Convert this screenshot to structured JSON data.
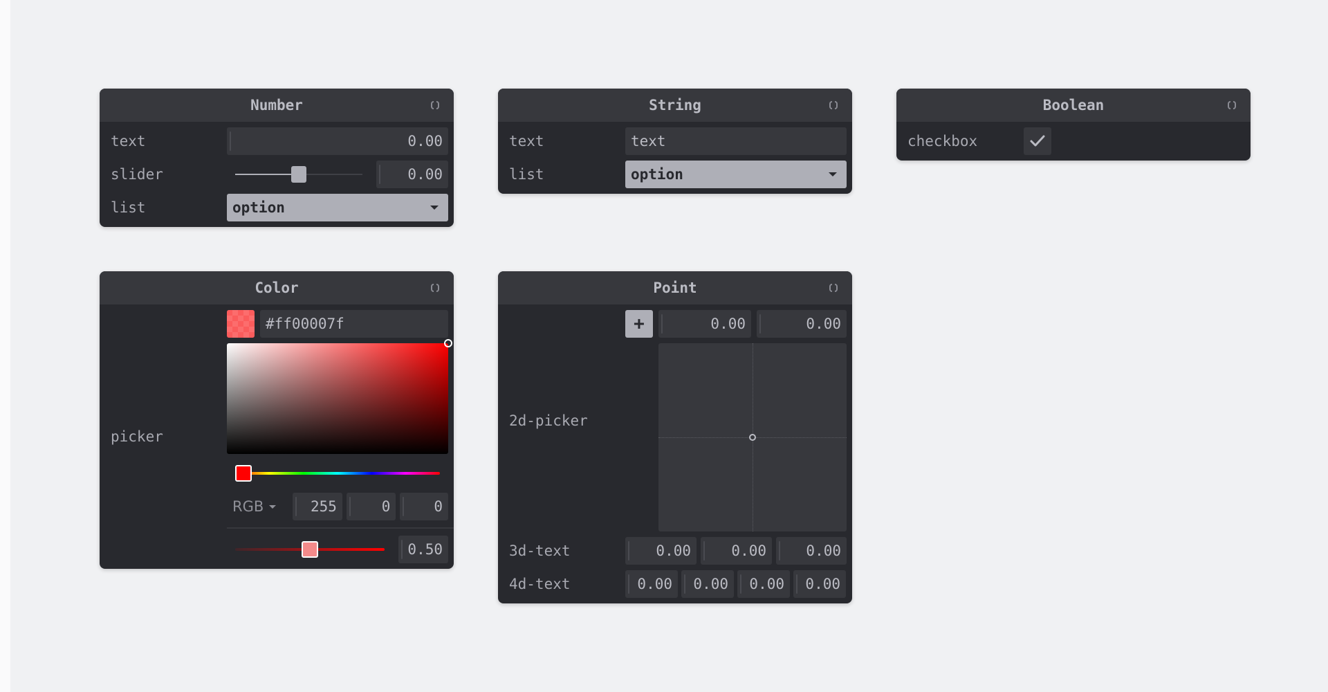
{
  "colors": {
    "page_bg": "#f0f1f3",
    "panel_bg": "#28292e",
    "header_bg": "#37383d",
    "accent": "#aeafb7",
    "picked_color": "#ff00007f"
  },
  "icons": {
    "fold": "fold-icon",
    "check": "check-icon",
    "plus": "plus-icon",
    "caret": "chevron-down-icon"
  },
  "number_panel": {
    "title": "Number",
    "text_label": "text",
    "text_value": "0.00",
    "slider_label": "slider",
    "slider_value": "0.00",
    "slider_fraction": 0.5,
    "list_label": "list",
    "list_value": "option"
  },
  "string_panel": {
    "title": "String",
    "text_label": "text",
    "text_value": "text",
    "list_label": "list",
    "list_value": "option"
  },
  "boolean_panel": {
    "title": "Boolean",
    "checkbox_label": "checkbox",
    "checked": true
  },
  "color_panel": {
    "title": "Color",
    "picker_label": "picker",
    "hex_value": "#ff00007f",
    "mode": "RGB",
    "r": "255",
    "g": "0",
    "b": "0",
    "alpha_value": "0.50",
    "alpha_fraction": 0.5
  },
  "point_panel": {
    "title": "Point",
    "picker_label": "2d-picker",
    "x_value": "0.00",
    "y_value": "0.00",
    "text3d_label": "3d-text",
    "text3d_values": [
      "0.00",
      "0.00",
      "0.00"
    ],
    "text4d_label": "4d-text",
    "text4d_values": [
      "0.00",
      "0.00",
      "0.00",
      "0.00"
    ]
  }
}
